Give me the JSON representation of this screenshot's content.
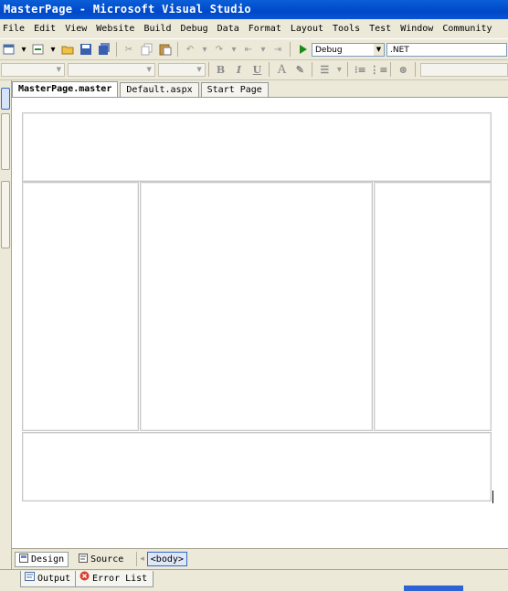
{
  "window": {
    "title": "MasterPage - Microsoft Visual Studio"
  },
  "menu": [
    "File",
    "Edit",
    "View",
    "Website",
    "Build",
    "Debug",
    "Data",
    "Format",
    "Layout",
    "Tools",
    "Test",
    "Window",
    "Community"
  ],
  "toolbar": {
    "config_value": "Debug",
    "platform_value": ".NET"
  },
  "format_toolbar": {
    "bold": "B",
    "italic": "I",
    "underline": "U",
    "font_color": "A"
  },
  "doc_tabs": [
    "MasterPage.master",
    "Default.aspx",
    "Start Page"
  ],
  "view_bar": {
    "design_label": "Design",
    "source_label": "Source",
    "breadcrumb": "<body>"
  },
  "output_tabs": [
    "Output",
    "Error List"
  ],
  "colors": {
    "title_bar": "#0048c8",
    "selection": "#316ac5"
  }
}
